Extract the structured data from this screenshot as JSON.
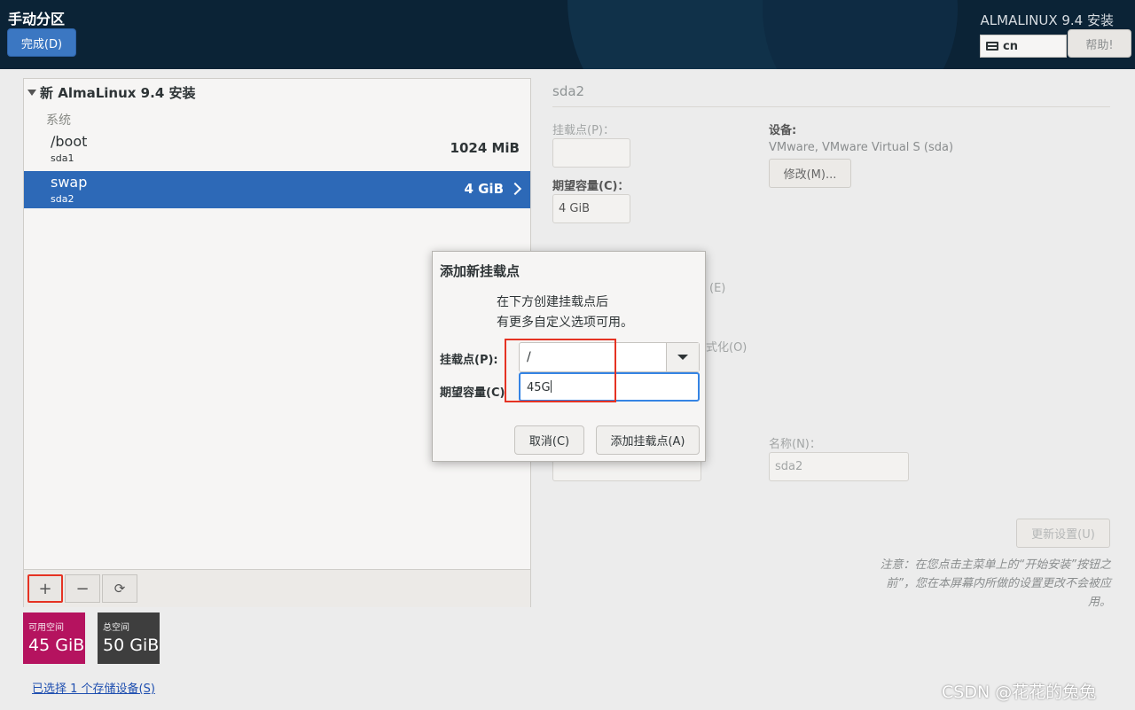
{
  "header": {
    "title": "手动分区",
    "done_label": "完成(D)",
    "product": "ALMALINUX 9.4 安装",
    "keyboard": "cn",
    "help_label": "帮助!"
  },
  "left": {
    "install_title": "新 AlmaLinux 9.4 安装",
    "section": "系统",
    "partitions": [
      {
        "name": "/boot",
        "device": "sda1",
        "size": "1024 MiB"
      },
      {
        "name": "swap",
        "device": "sda2",
        "size": "4 GiB"
      }
    ],
    "toolbar": {
      "add": "+",
      "remove": "−",
      "refresh": "⟳"
    },
    "available": {
      "label": "可用空间",
      "value": "45 GiB"
    },
    "total": {
      "label": "总空间",
      "value": "50 GiB"
    },
    "storage_link": "已选择 1 个存储设备(S)"
  },
  "right": {
    "title": "sda2",
    "mount_label": "挂载点(P)：",
    "capacity_label": "期望容量(C)：",
    "capacity_value": "4 GiB",
    "device_label": "设备:",
    "device_value": "VMware, VMware Virtual S (sda)",
    "modify_label": "修改(M)...",
    "partial1": "(E)",
    "partial2": "式化(O)",
    "name_label": "名称(N)：",
    "name_value": "sda2",
    "update_label": "更新设置(U)",
    "note": "注意：在您点击主菜单上的“开始安装”按钮之前”，您在本屏幕内所做的设置更改不会被应用。"
  },
  "dialog": {
    "title": "添加新挂载点",
    "desc_line1": "在下方创建挂载点后",
    "desc_line2": "有更多自定义选项可用。",
    "mount_label": "挂载点(P):",
    "mount_value": "/",
    "capacity_label": "期望容量(C)",
    "capacity_value": "45G",
    "cancel_label": "取消(C)",
    "add_label": "添加挂载点(A)"
  },
  "watermark": "CSDN @花花的兔兔"
}
